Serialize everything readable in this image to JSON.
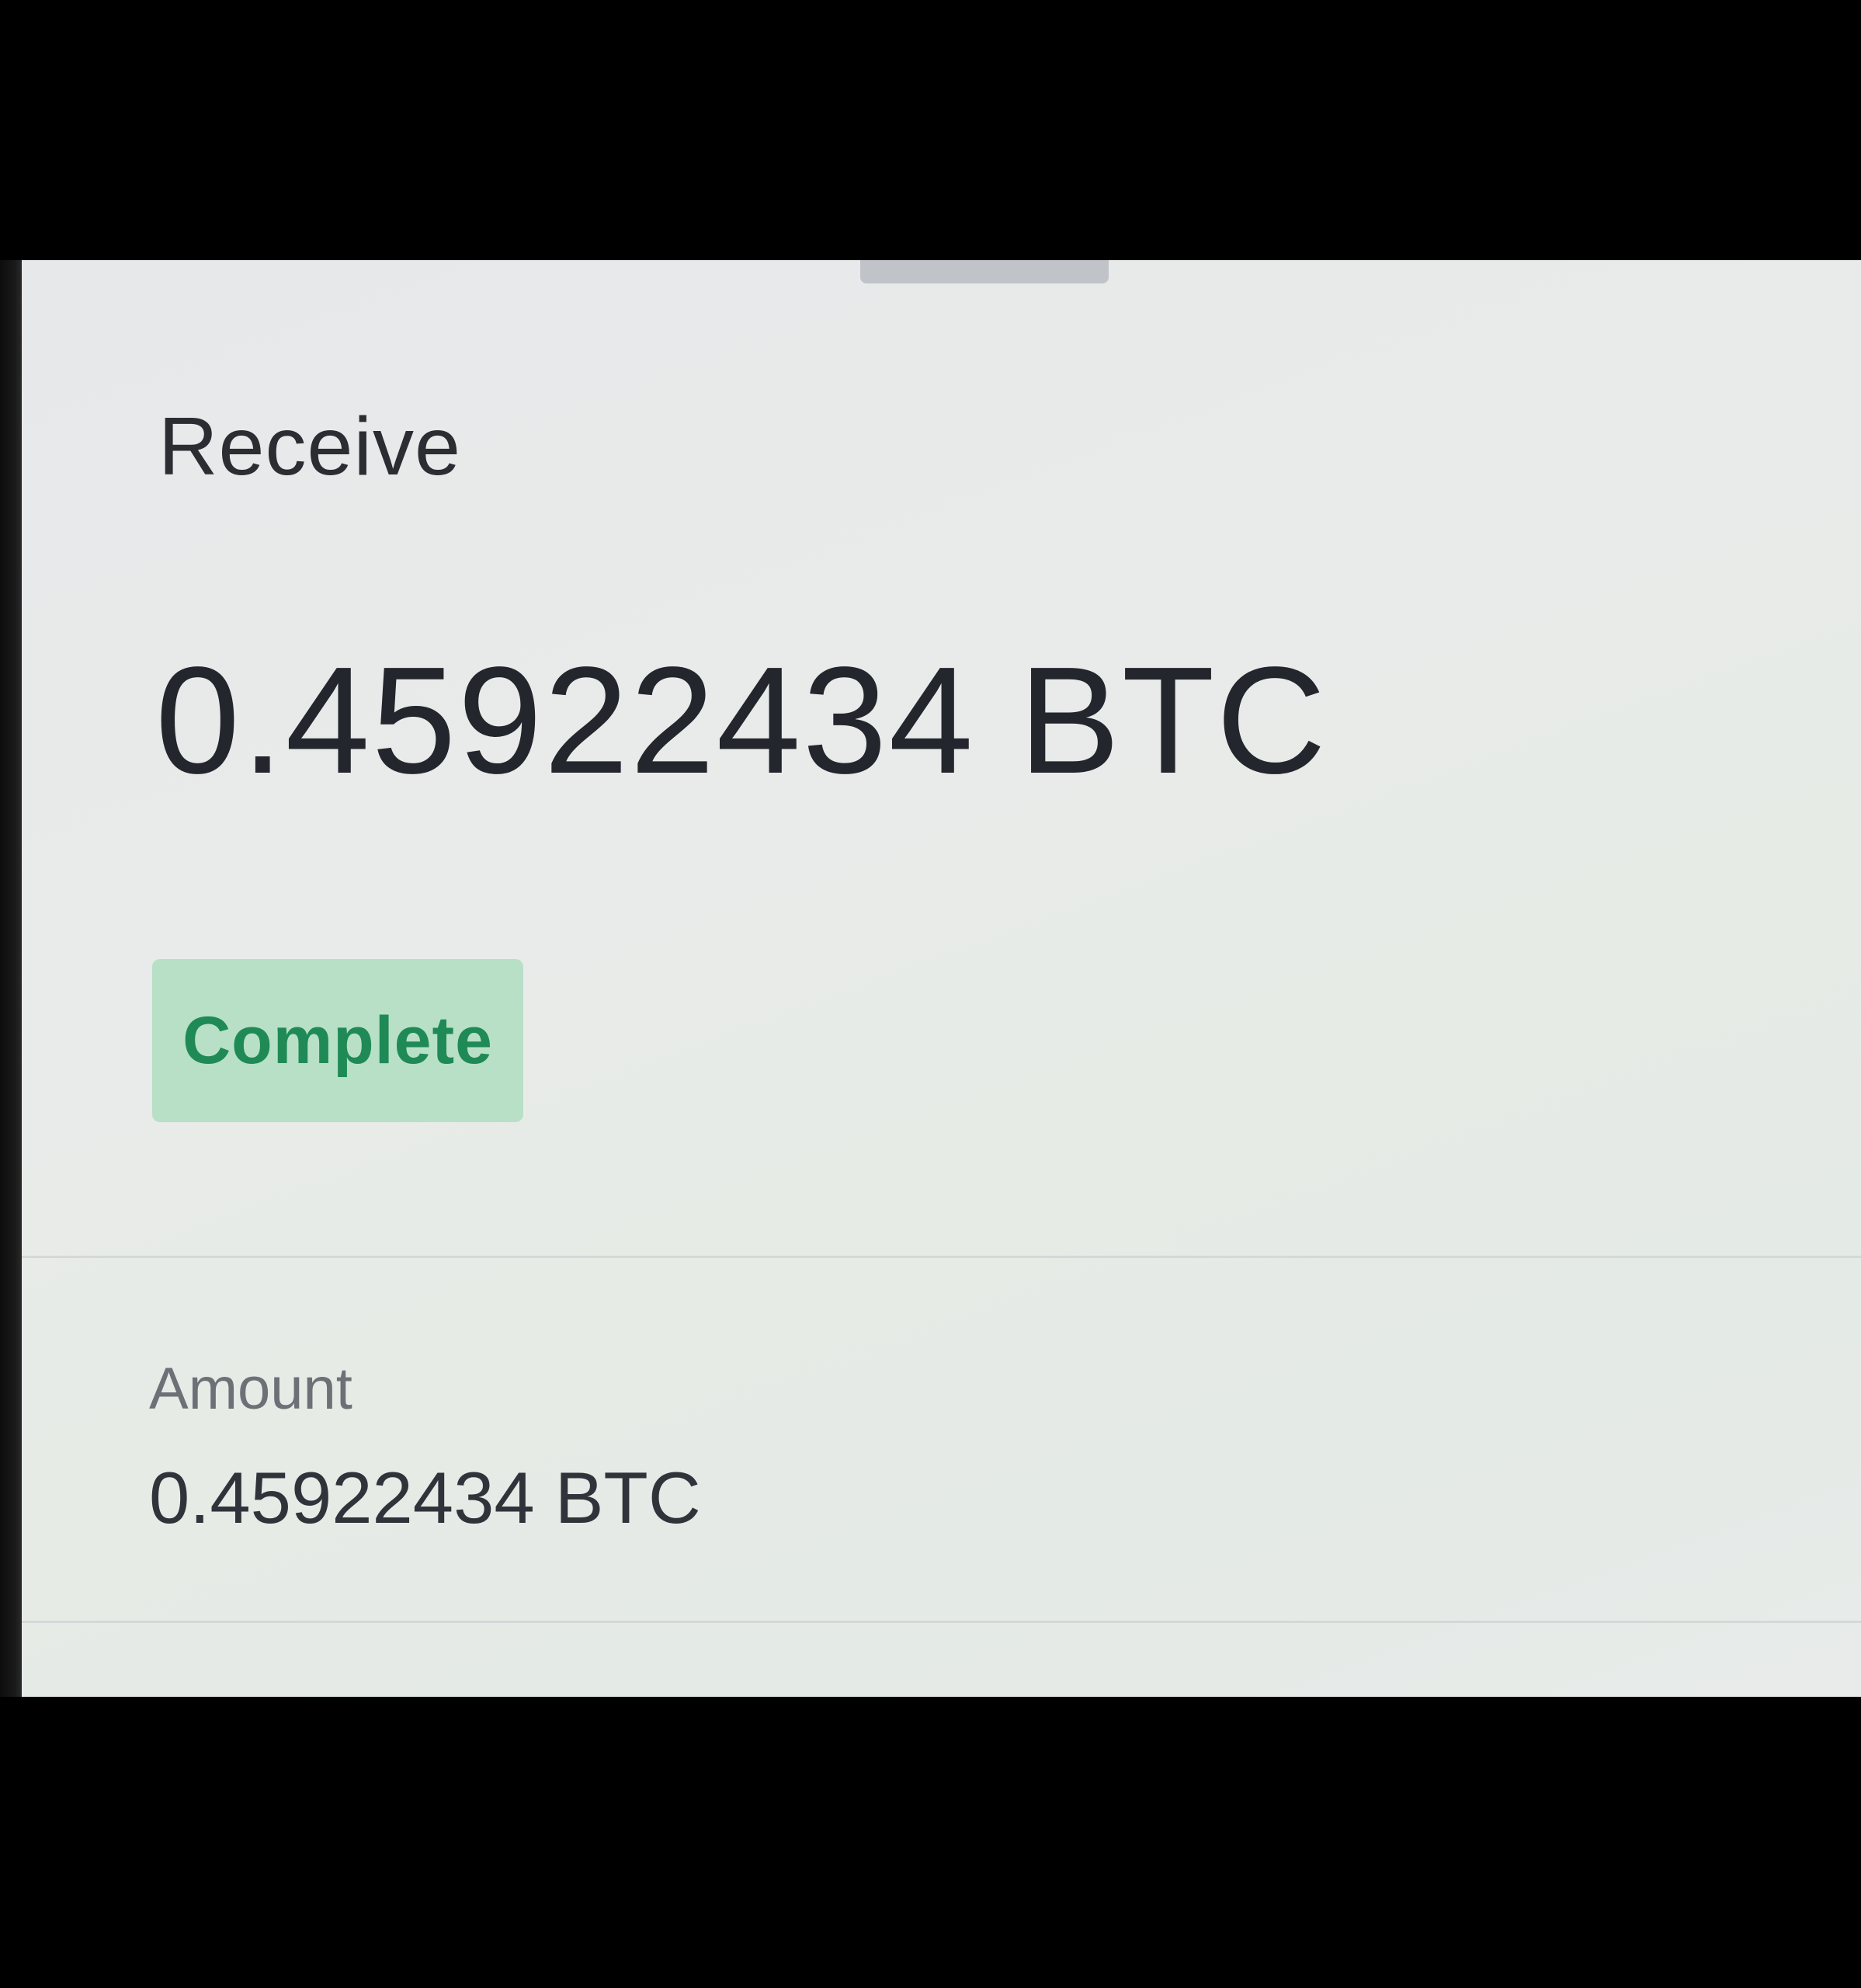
{
  "header": {
    "title": "Receive"
  },
  "transaction": {
    "amount_display": "0.45922434 BTC",
    "status": "Complete",
    "status_color": "#1f8a55",
    "status_bg": "#b8e0c6"
  },
  "details": {
    "amount_label": "Amount",
    "amount_value": "0.45922434 BTC"
  }
}
